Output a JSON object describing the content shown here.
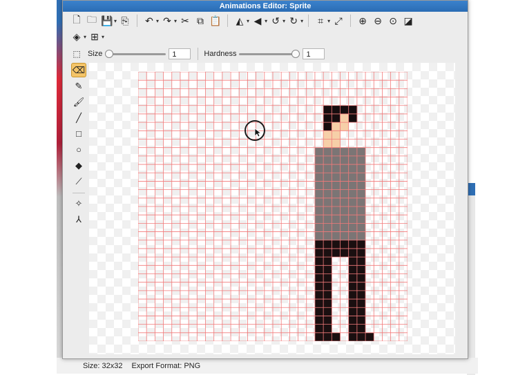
{
  "window": {
    "title": "Animations Editor: Sprite"
  },
  "toolbar": {
    "row1": [
      {
        "name": "new-file-icon",
        "glyph": "🗋"
      },
      {
        "name": "open-folder-icon",
        "glyph": "🗀"
      },
      {
        "name": "save-icon",
        "glyph": "💾",
        "caret": true
      },
      {
        "name": "export-icon",
        "glyph": "⎘"
      },
      {
        "sep": true
      },
      {
        "name": "undo-icon",
        "glyph": "↶",
        "caret": true
      },
      {
        "name": "redo-icon",
        "glyph": "↷",
        "caret": true
      },
      {
        "name": "cut-icon",
        "glyph": "✂"
      },
      {
        "name": "copy-icon",
        "glyph": "⧉"
      },
      {
        "name": "paste-icon",
        "glyph": "📋"
      },
      {
        "sep": true
      },
      {
        "name": "flip-horizontal-icon",
        "glyph": "◭",
        "caret": true
      },
      {
        "name": "flip-vertical-icon",
        "glyph": "◀",
        "caret": true
      },
      {
        "name": "rotate-left-icon",
        "glyph": "↺",
        "caret": true
      },
      {
        "name": "rotate-right-icon",
        "glyph": "↻",
        "caret": true
      },
      {
        "sep": true
      },
      {
        "name": "crop-icon",
        "glyph": "⌗",
        "caret": true
      },
      {
        "name": "resize-icon",
        "glyph": "⤢"
      },
      {
        "sep": true
      },
      {
        "name": "zoom-in-icon",
        "glyph": "⊕"
      },
      {
        "name": "zoom-out-icon",
        "glyph": "⊖"
      },
      {
        "name": "zoom-fit-icon",
        "glyph": "⊙"
      },
      {
        "name": "toggle-background-icon",
        "glyph": "◪"
      }
    ],
    "row2": [
      {
        "name": "layers-icon",
        "glyph": "◈",
        "caret": true
      },
      {
        "name": "grid-icon",
        "glyph": "⊞",
        "caret": true
      }
    ]
  },
  "options": {
    "size_label": "Size",
    "size_value": "1",
    "size_fraction": 0.0,
    "hardness_label": "Hardness",
    "hardness_value": "1",
    "hardness_fraction": 1.0
  },
  "tools": [
    {
      "name": "eraser-tool-icon",
      "glyph": "⌫",
      "active": true
    },
    {
      "name": "pencil-tool-icon",
      "glyph": "✎"
    },
    {
      "name": "brush-tool-icon",
      "glyph": "🖌"
    },
    {
      "name": "line-tool-icon",
      "glyph": "╱"
    },
    {
      "name": "rectangle-tool-icon",
      "glyph": "□"
    },
    {
      "name": "ellipse-tool-icon",
      "glyph": "○"
    },
    {
      "name": "fill-bucket-tool-icon",
      "glyph": "◆"
    },
    {
      "name": "eyedropper-tool-icon",
      "glyph": "⟋"
    },
    {
      "sep": true
    },
    {
      "name": "select-point-tool-icon",
      "glyph": "✧"
    },
    {
      "name": "node-tool-icon",
      "glyph": "⅄"
    }
  ],
  "sprite": {
    "grid_size": 32,
    "grid_color": "#f27a7a",
    "palette": {
      "h": "#160d0f",
      "s": "#f6cfa8",
      "g": "#7b7575",
      "b": "#1a0f10"
    },
    "rows": {
      "4": "......................hhhh......",
      "5": "......................hhsh......",
      "6": "......................hss.......",
      "7": "......................ss........",
      "8": "......................ss........",
      "9": ".....................gggggg.....",
      "10": ".....................gggggg.....",
      "11": ".....................gggggg.....",
      "12": ".....................gggggg.....",
      "13": ".....................gggggg.....",
      "14": ".....................gggggg.....",
      "15": ".....................gggggg.....",
      "16": ".....................gggggg.....",
      "17": ".....................gggggg.....",
      "18": ".....................gggggg.....",
      "19": ".....................gggggg.....",
      "20": ".....................bbbbbb.....",
      "21": ".....................bbbbbb.....",
      "22": ".....................bb..bb.....",
      "23": ".....................bb..bb.....",
      "24": ".....................bb..bb.....",
      "25": ".....................bb..bb.....",
      "26": ".....................bb..bb.....",
      "27": ".....................bb..bb.....",
      "28": ".....................bb..bb.....",
      "29": ".....................bb..bb.....",
      "30": ".....................bb..bb.....",
      "31": ".....................bbb.bbb...."
    }
  },
  "status": {
    "size": "Size: 32x32",
    "export": "Export Format: PNG"
  }
}
